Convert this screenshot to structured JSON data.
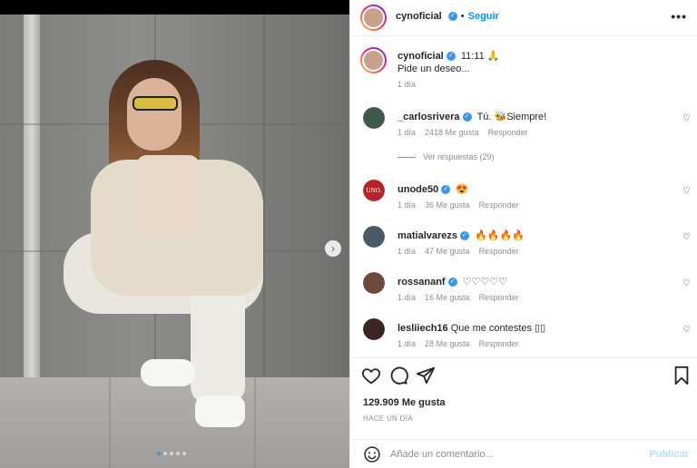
{
  "post": {
    "author": "cynoficial",
    "follow_label": "Seguir",
    "more_icon": "more-horizontal-icon",
    "caption_time": "11:11",
    "caption_emoji": "🙏",
    "caption_text": "Pide un deseo...",
    "caption_age": "1 día",
    "carousel_dots": 5,
    "carousel_active": 0
  },
  "comments": [
    {
      "user": "_carlosrivera",
      "text": "Tú. 🐝Siempre!",
      "age": "1 día",
      "likes": "2418 Me gusta",
      "reply": "Responder",
      "verified": true,
      "avatar_color": "#3d5a4a"
    },
    {
      "user": "unode50",
      "text": "😍",
      "age": "1 día",
      "likes": "36 Me gusta",
      "reply": "Responder",
      "verified": true,
      "avatar_color": "#b8232b",
      "avatar_text": "UNO."
    },
    {
      "user": "matialvarezs",
      "text": "🔥🔥🔥🔥",
      "age": "1 día",
      "likes": "47 Me gusta",
      "reply": "Responder",
      "verified": true,
      "avatar_color": "#4b5966"
    },
    {
      "user": "rossananf",
      "text": "♡♡♡♡♡",
      "age": "1 día",
      "likes": "16 Me gusta",
      "reply": "Responder",
      "verified": true,
      "avatar_color": "#6e4a3a"
    },
    {
      "user": "lesliiech16",
      "text": "Que me contestes ▯▯",
      "age": "1 día",
      "likes": "28 Me gusta",
      "reply": "Responder",
      "verified": false,
      "avatar_color": "#3a2624"
    }
  ],
  "view_replies": "Ver respuestas (29)",
  "likes_total": "129.909 Me gusta",
  "posted_when": "HACE UN DÍA",
  "add_comment": {
    "placeholder": "Añade un comentario...",
    "publish_label": "Publicar"
  },
  "colors": {
    "accent": "#0095f6",
    "verified": "#3897f0",
    "muted": "#8e8e8e",
    "publish_disabled": "#b2dffc"
  }
}
